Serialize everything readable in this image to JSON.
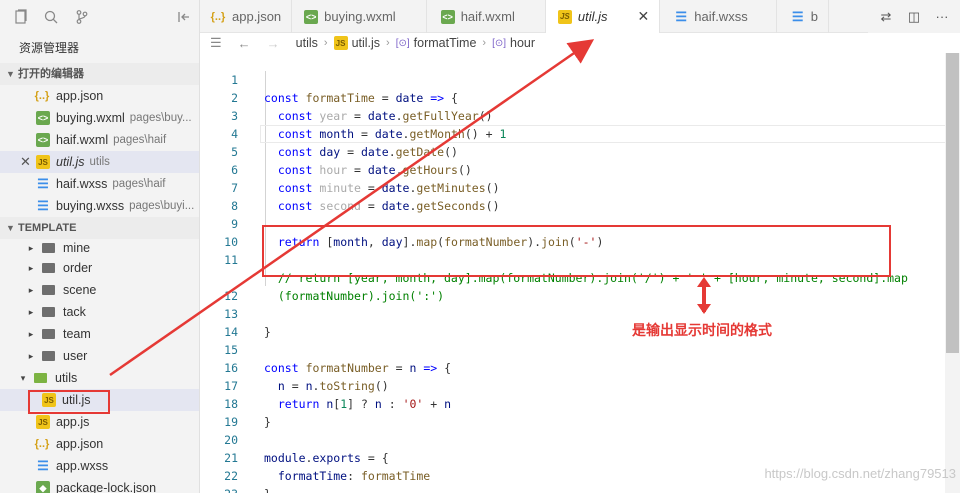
{
  "sidebar": {
    "title": "资源管理器",
    "open_editors": {
      "label": "打开的编辑器",
      "items": [
        {
          "icon": "json",
          "name": "app.json",
          "path": ""
        },
        {
          "icon": "wxml",
          "name": "buying.wxml",
          "path": "pages\\buy..."
        },
        {
          "icon": "wxml",
          "name": "haif.wxml",
          "path": "pages\\haif"
        },
        {
          "icon": "js",
          "name": "util.js",
          "path": "utils"
        },
        {
          "icon": "wxss",
          "name": "haif.wxss",
          "path": "pages\\haif"
        },
        {
          "icon": "wxss",
          "name": "buying.wxss",
          "path": "pages\\buyi..."
        }
      ]
    },
    "template": {
      "label": "TEMPLATE",
      "folders": [
        "mine",
        "order",
        "scene",
        "tack",
        "team",
        "user"
      ],
      "utils_folder": "utils",
      "utils_file": "util.js",
      "root_files": [
        {
          "icon": "js",
          "name": "app.js"
        },
        {
          "icon": "json",
          "name": "app.json"
        },
        {
          "icon": "wxss",
          "name": "app.wxss"
        },
        {
          "icon": "pkg",
          "name": "package-lock.json"
        }
      ]
    }
  },
  "tabs": [
    {
      "icon": "json",
      "label": "app.json"
    },
    {
      "icon": "wxml",
      "label": "buying.wxml"
    },
    {
      "icon": "wxml",
      "label": "haif.wxml"
    },
    {
      "icon": "js",
      "label": "util.js"
    },
    {
      "icon": "wxss",
      "label": "haif.wxss"
    },
    {
      "icon": "wxss",
      "label": "b"
    }
  ],
  "breadcrumb": {
    "folder": "utils",
    "file": "util.js",
    "symbol1": "formatTime",
    "symbol2": "hour"
  },
  "editor": {
    "line_numbers": [
      "1",
      "2",
      "3",
      "4",
      "5",
      "6",
      "7",
      "8",
      "9",
      "10",
      "11",
      "",
      "12",
      "13",
      "14",
      "15",
      "16",
      "17",
      "18",
      "19",
      "20",
      "21",
      "22",
      "23"
    ],
    "lines": [
      "const formatTime = date => {",
      "  const year = date.getFullYear()",
      "  const month = date.getMonth() + 1",
      "  const day = date.getDate()",
      "  const hour = date.getHours()",
      "  const minute = date.getMinutes()",
      "  const second = date.getSeconds()",
      "",
      "  return [month, day].map(formatNumber).join('-')",
      "",
      "  // return [year, month, day].map(formatNumber).join('/') + ' ' + [hour, minute, second].map",
      "  (formatNumber).join(':')",
      "",
      "}",
      "",
      "const formatNumber = n => {",
      "  n = n.toString()",
      "  return n[1] ? n : '0' + n",
      "}",
      "",
      "module.exports = {",
      "  formatTime: formatTime",
      "}",
      ""
    ]
  },
  "annotation": {
    "note": "是输出显示时间的格式",
    "color": "#e53935"
  },
  "watermark": "https://blog.csdn.net/zhang79513"
}
